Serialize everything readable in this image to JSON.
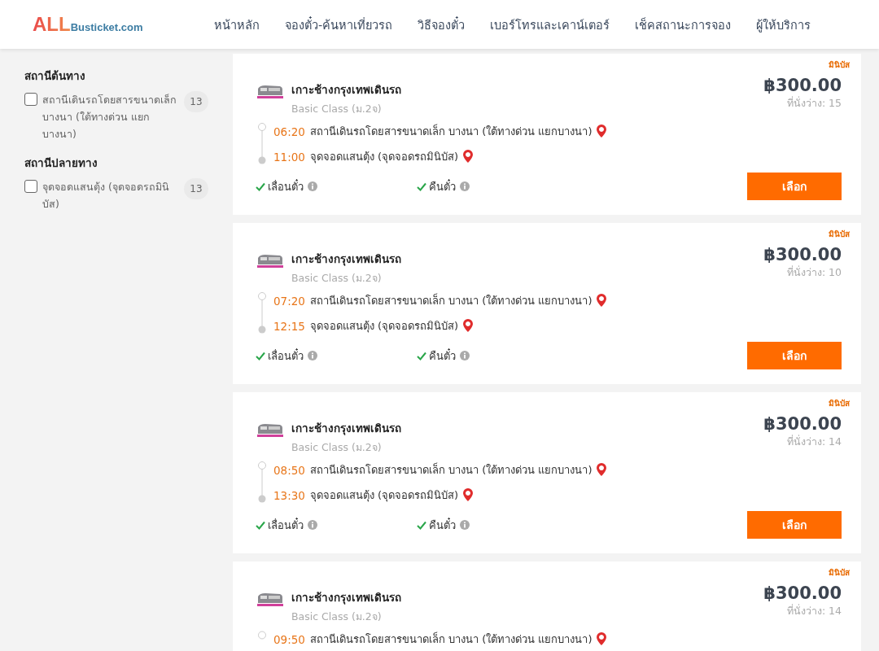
{
  "logo": {
    "main": "ALL",
    "suffix": "Busticket.com"
  },
  "nav": [
    {
      "label": "หน้าหลัก"
    },
    {
      "label": "จองตั๋ว-ค้นหาเที่ยวรถ"
    },
    {
      "label": "วิธีจองตั๋ว"
    },
    {
      "label": "เบอร์โทรและเคาน์เตอร์"
    },
    {
      "label": "เช็คสถานะการจอง"
    },
    {
      "label": "ผู้ให้บริการ"
    }
  ],
  "filters": [
    {
      "title": "สถานีต้นทาง",
      "options": [
        {
          "label": "สถานีเดินรถโดยสารขนาดเล็ก บางนา (ใต้ทางด่วน แยกบางนา)",
          "count": "13",
          "checked": false
        }
      ]
    },
    {
      "title": "สถานีปลายทาง",
      "options": [
        {
          "label": "จุดจอดแสนตุ้ง (จุดจอดรถมินิบัส)",
          "count": "13",
          "checked": false
        }
      ]
    }
  ],
  "trips": [
    {
      "badge": "มินิบัส",
      "operator": "เกาะช้างกรุงเทพเดินรถ",
      "class": "Basic Class (ม.2จ)",
      "price": "฿300.00",
      "seats": "ที่นั่งว่าง: 15",
      "stops": [
        {
          "kind": "origin",
          "time": "06:20",
          "place": "สถานีเดินรถโดยสารขนาดเล็ก บางนา (ใต้ทางด่วน แยกบางนา)"
        },
        {
          "kind": "destination",
          "time": "11:00",
          "place": "จุดจอดแสนตุ้ง (จุดจอดรถมินิบัส)"
        }
      ],
      "features": [
        {
          "label": "เลื่อนตั๋ว"
        },
        {
          "label": "คืนตั๋ว"
        }
      ],
      "button": "เลือก"
    },
    {
      "badge": "มินิบัส",
      "operator": "เกาะช้างกรุงเทพเดินรถ",
      "class": "Basic Class (ม.2จ)",
      "price": "฿300.00",
      "seats": "ที่นั่งว่าง: 10",
      "stops": [
        {
          "kind": "origin",
          "time": "07:20",
          "place": "สถานีเดินรถโดยสารขนาดเล็ก บางนา (ใต้ทางด่วน แยกบางนา)"
        },
        {
          "kind": "destination",
          "time": "12:15",
          "place": "จุดจอดแสนตุ้ง (จุดจอดรถมินิบัส)"
        }
      ],
      "features": [
        {
          "label": "เลื่อนตั๋ว"
        },
        {
          "label": "คืนตั๋ว"
        }
      ],
      "button": "เลือก"
    },
    {
      "badge": "มินิบัส",
      "operator": "เกาะช้างกรุงเทพเดินรถ",
      "class": "Basic Class (ม.2จ)",
      "price": "฿300.00",
      "seats": "ที่นั่งว่าง: 14",
      "stops": [
        {
          "kind": "origin",
          "time": "08:50",
          "place": "สถานีเดินรถโดยสารขนาดเล็ก บางนา (ใต้ทางด่วน แยกบางนา)"
        },
        {
          "kind": "destination",
          "time": "13:30",
          "place": "จุดจอดแสนตุ้ง (จุดจอดรถมินิบัส)"
        }
      ],
      "features": [
        {
          "label": "เลื่อนตั๋ว"
        },
        {
          "label": "คืนตั๋ว"
        }
      ],
      "button": "เลือก"
    },
    {
      "badge": "มินิบัส",
      "operator": "เกาะช้างกรุงเทพเดินรถ",
      "class": "Basic Class (ม.2จ)",
      "price": "฿300.00",
      "seats": "ที่นั่งว่าง: 14",
      "stops": [
        {
          "kind": "origin",
          "time": "09:50",
          "place": "สถานีเดินรถโดยสารขนาดเล็ก บางนา (ใต้ทางด่วน แยกบางนา)"
        }
      ]
    }
  ]
}
